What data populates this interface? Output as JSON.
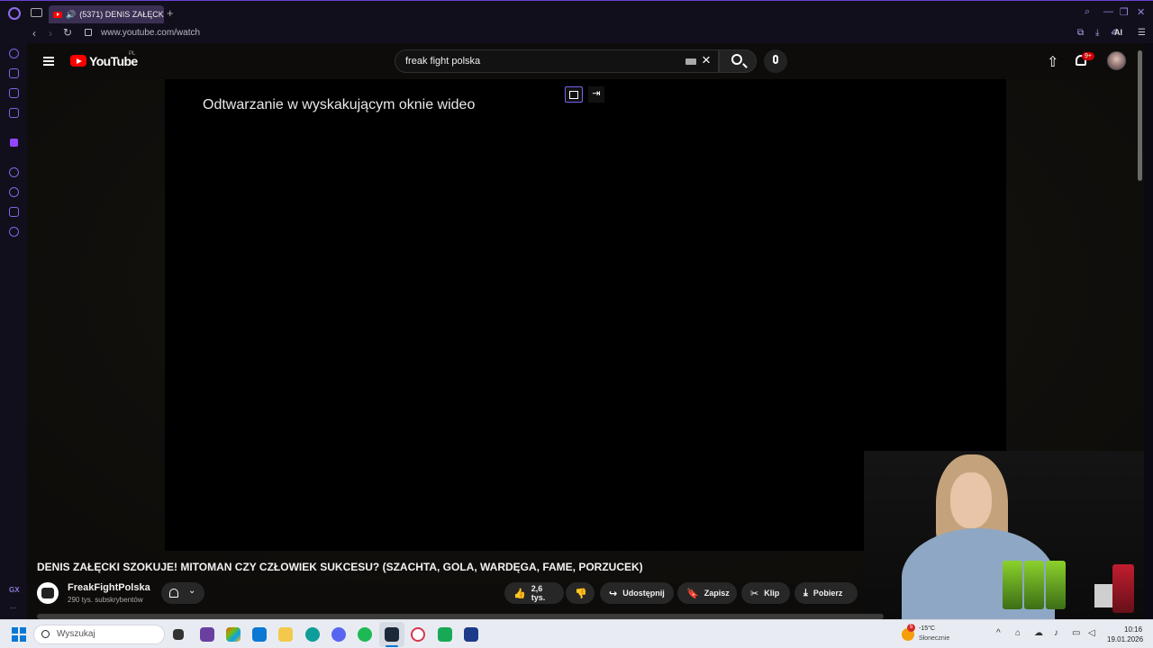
{
  "browser": {
    "tab_title": "(5371) DENIS ZAŁĘCKI",
    "new_tab": "+",
    "url": "www.youtube.com/watch",
    "ai_label": "AI",
    "sidebar_gx": "GX",
    "sidebar_more": "...",
    "accent_color": "#7f66e6"
  },
  "youtube": {
    "logo_text": "YouTube",
    "country": "PL",
    "search_value": "freak fight polska",
    "notifications": "9+"
  },
  "player": {
    "popup_message": "Odtwarzanie w wyskakującym oknie wideo"
  },
  "video": {
    "title": "DENIS ZAŁĘCKI SZOKUJE! MITOMAN CZY CZŁOWIEK SUKCESU? (SZACHTA, GOLA, WARDĘGA, FAME, PORZUCEK)",
    "channel_name": "FreakFightPolska",
    "subscribers": "290 tys. subskrybentów",
    "likes": "2,6 tys.",
    "share_label": "Udostępnij",
    "save_label": "Zapisz",
    "clip_label": "Klip",
    "download_label": "Pobierz"
  },
  "taskbar": {
    "search_placeholder": "Wyszukaj",
    "weather_temp": "-15°C",
    "weather_desc": "Słonecznie",
    "weather_badge": "5",
    "time": "10:16",
    "date": "19.01.2026"
  }
}
